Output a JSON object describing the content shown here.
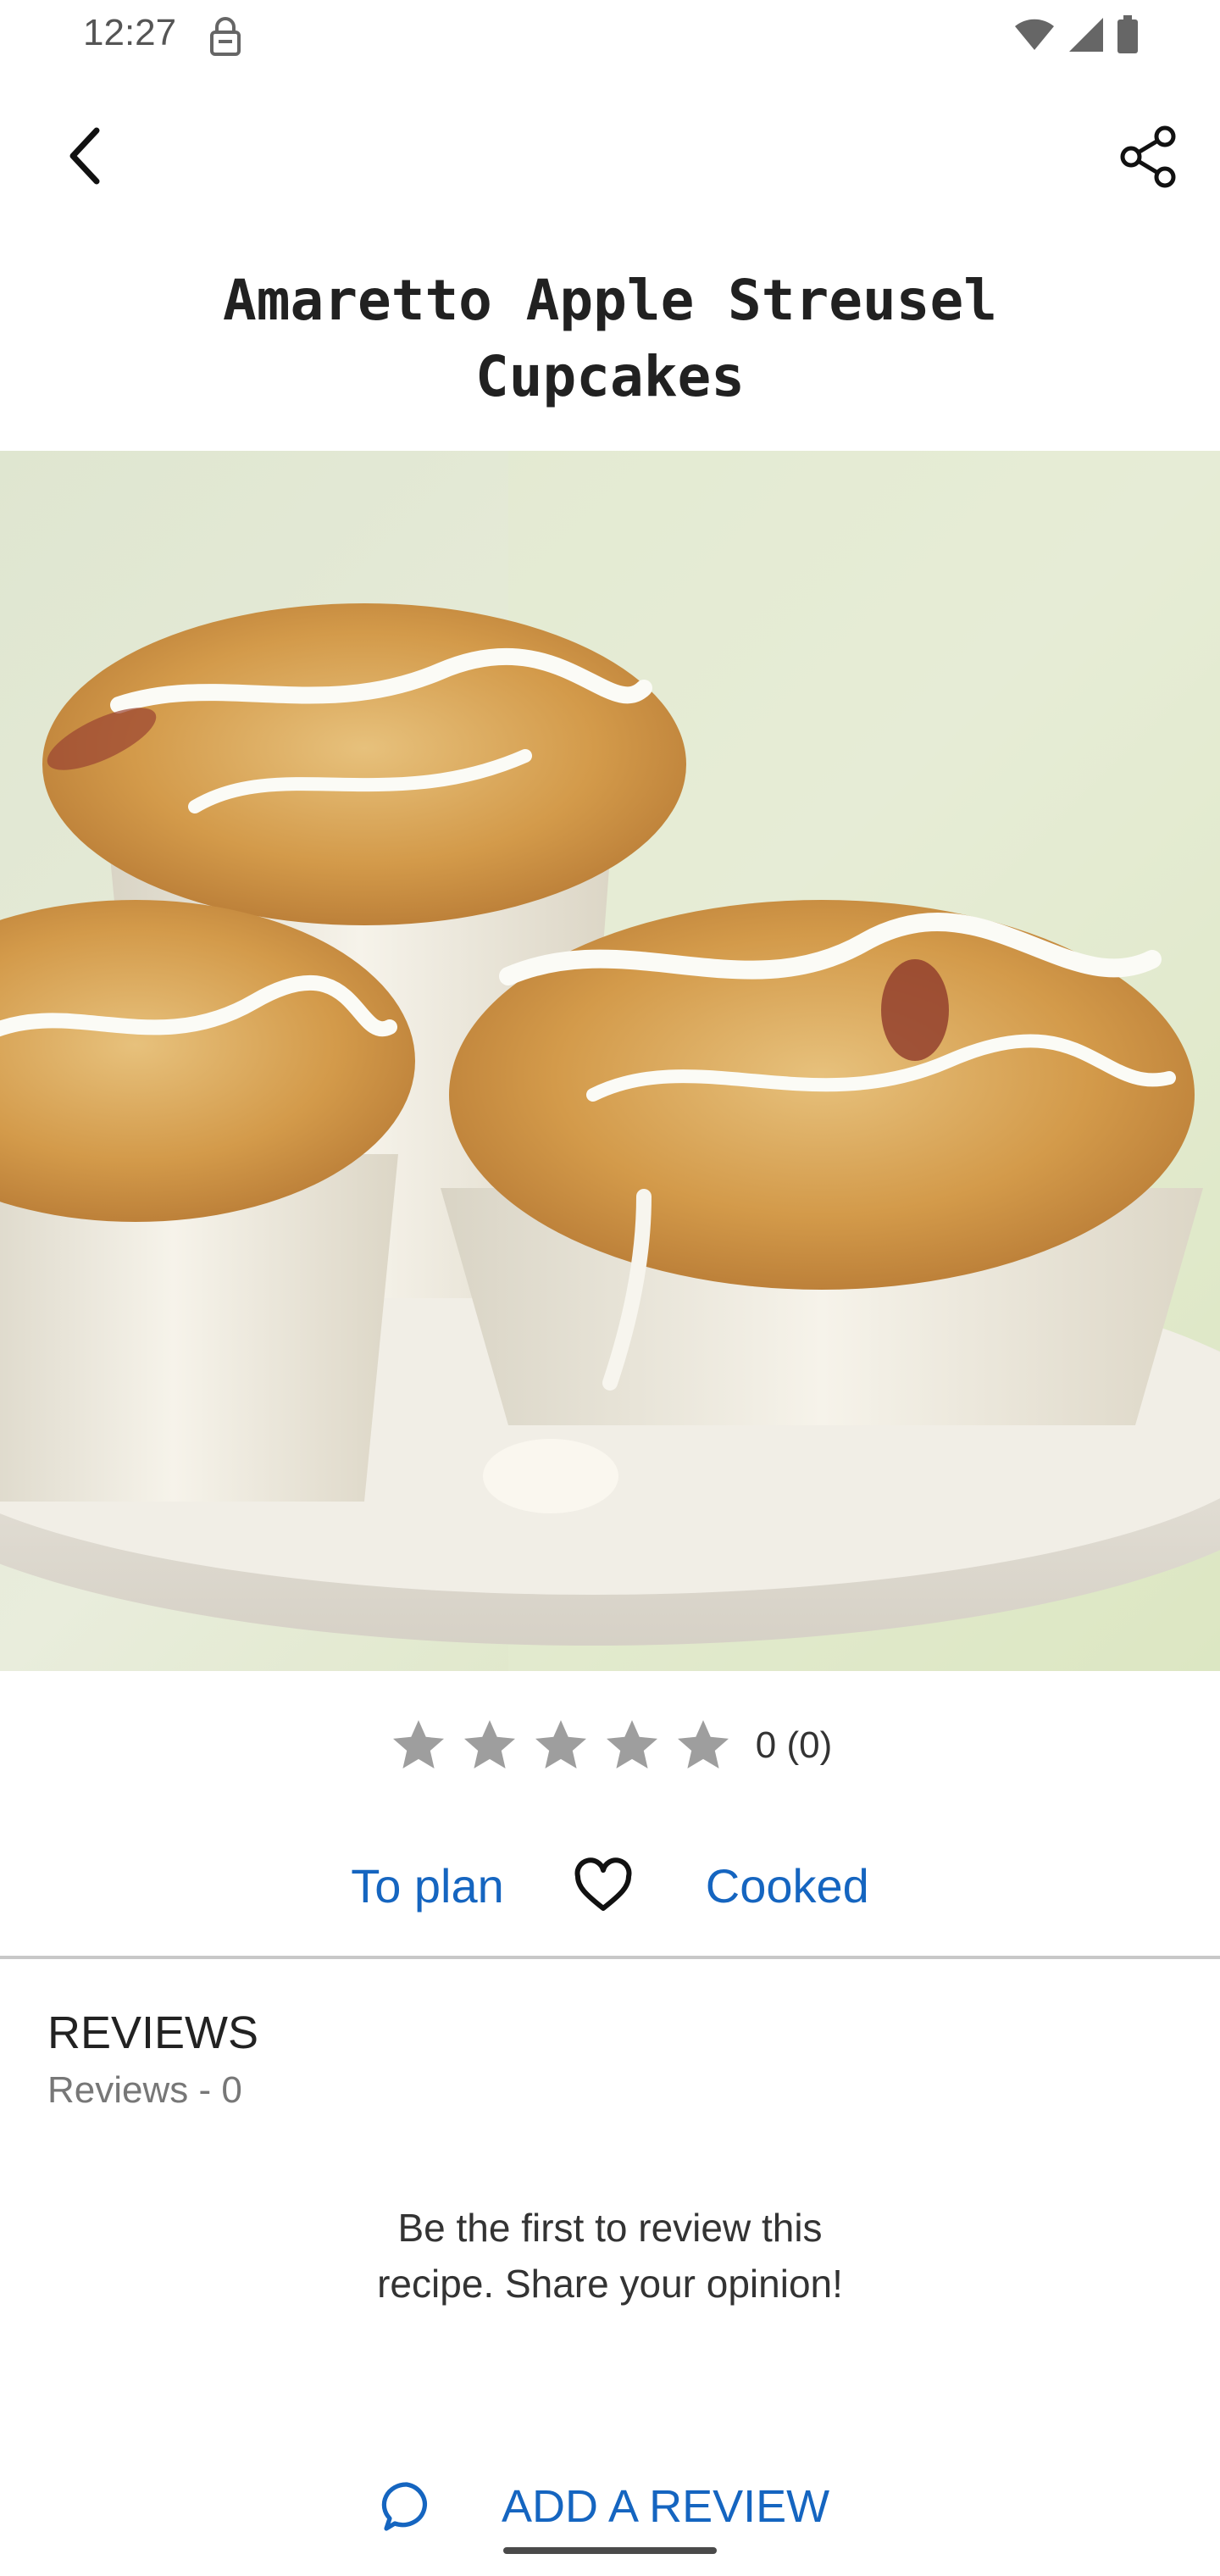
{
  "status_bar": {
    "time": "12:27",
    "icons": [
      "lock-icon",
      "wifi-icon",
      "signal-icon",
      "battery-icon"
    ]
  },
  "app_bar": {
    "back_icon": "back-arrow-icon",
    "share_icon": "share-icon"
  },
  "recipe": {
    "title_line1": "Amaretto Apple Streusel",
    "title_line2": "Cupcakes",
    "image": "photo of three glazed streusel cupcakes on a white cake stand"
  },
  "rating": {
    "stars_total": 5,
    "stars_filled": 0,
    "text": "0 (0)",
    "star_color": "#9e9e9e"
  },
  "actions": {
    "to_plan": "To plan",
    "favorite_icon": "heart-icon",
    "cooked": "Cooked",
    "link_color": "#1565c0"
  },
  "reviews": {
    "heading": "REVIEWS",
    "count_text": "Reviews - 0",
    "empty_line1": "Be the first to review this",
    "empty_line2": "recipe. Share your opinion!",
    "add_label": "ADD A REVIEW",
    "add_icon": "comment-icon"
  }
}
